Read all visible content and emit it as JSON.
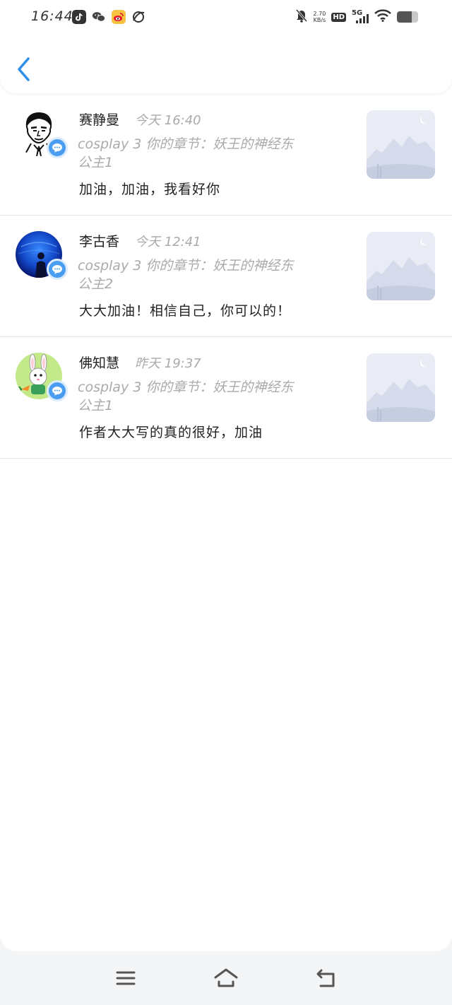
{
  "status_bar": {
    "time": "16:44",
    "net_speed_value": "2.70",
    "net_speed_unit": "KB/s",
    "hd_label": "HD",
    "network_label": "5G",
    "battery_level": 0.7
  },
  "header": {
    "back_icon": "chevron-left-icon"
  },
  "comments": [
    {
      "name": "赛静曼",
      "time": "今天 16:40",
      "chapter_line1": "cosplay 3 你的章节：妖王的神经东",
      "chapter_line2": "公主1",
      "comment": "加油，加油，我看好你",
      "avatar": "sketch-man"
    },
    {
      "name": "李古香",
      "time": "今天 12:41",
      "chapter_line1": "cosplay 3 你的章节：妖王的神经东",
      "chapter_line2": "公主2",
      "comment": "大大加油！相信自己，你可以的！",
      "avatar": "blue-aquarium"
    },
    {
      "name": "佛知慧",
      "time": "昨天 19:37",
      "chapter_line1": "cosplay 3 你的章节：妖王的神经东",
      "chapter_line2": "公主1",
      "comment": "作者大大写的真的很好，加油",
      "avatar": "rabbit-cartoon"
    }
  ],
  "colors": {
    "accent": "#2f8fe8",
    "badge": "#4a9df0",
    "muted_text": "#aaaaaa"
  },
  "navbar": {
    "menu_icon": "menu-icon",
    "home_icon": "home-icon",
    "back_icon": "back-icon"
  }
}
